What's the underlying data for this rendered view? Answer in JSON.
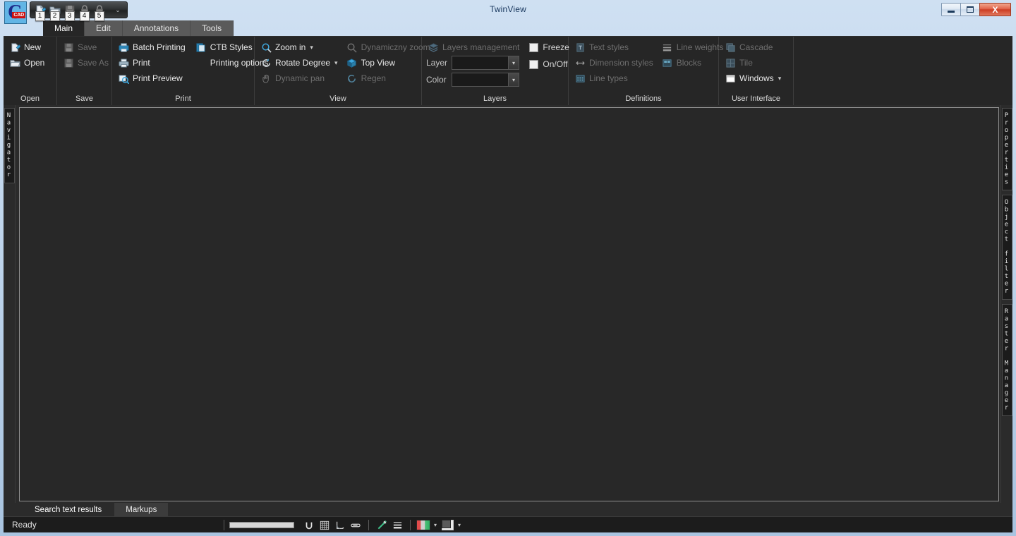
{
  "window": {
    "title": "TwinView",
    "minimize_label": "Minimize",
    "maximize_label": "Maximize",
    "close_label": "X"
  },
  "logo": {
    "letter": "C",
    "badge": "CAD"
  },
  "quick_access": {
    "items": [
      {
        "name": "new-document",
        "keytip": "1"
      },
      {
        "name": "open-document",
        "keytip": "2"
      },
      {
        "name": "save-document",
        "keytip": "3"
      },
      {
        "name": "lock-a",
        "keytip": "4"
      },
      {
        "name": "lock-b",
        "keytip": "5"
      }
    ],
    "customize_caret": "⌄"
  },
  "ribbon_tabs": [
    {
      "label": "Main",
      "active": true
    },
    {
      "label": "Edit",
      "active": false
    },
    {
      "label": "Annotations",
      "active": false
    },
    {
      "label": "Tools",
      "active": false
    }
  ],
  "ribbon": {
    "groups": [
      {
        "title": "Open",
        "items": [
          {
            "label": "New",
            "icon": "new-file-icon",
            "disabled": false
          },
          {
            "label": "Open",
            "icon": "open-folder-icon",
            "disabled": false
          }
        ]
      },
      {
        "title": "Save",
        "items": [
          {
            "label": "Save",
            "icon": "save-disk-icon",
            "disabled": true
          },
          {
            "label": "Save As",
            "icon": "save-as-disk-icon",
            "disabled": true
          }
        ]
      },
      {
        "title": "Print",
        "col1": [
          {
            "label": "Batch Printing",
            "icon": "batch-printing-icon",
            "disabled": false
          },
          {
            "label": "Print",
            "icon": "printer-icon",
            "disabled": false
          },
          {
            "label": "Print Preview",
            "icon": "print-preview-icon",
            "disabled": false
          }
        ],
        "col2": [
          {
            "label": "CTB Styles",
            "icon": "ctb-styles-icon",
            "disabled": false
          },
          {
            "label": "Printing options",
            "icon": "none",
            "disabled": false
          }
        ]
      },
      {
        "title": "View",
        "col1": [
          {
            "label": "Zoom in",
            "icon": "zoom-in-icon",
            "disabled": false,
            "caret": true
          },
          {
            "label": "Rotate Degree",
            "icon": "rotate-icon",
            "disabled": false,
            "caret": true
          },
          {
            "label": "Dynamic pan",
            "icon": "hand-pan-icon",
            "disabled": true
          }
        ],
        "col2": [
          {
            "label": "Dynamiczny zoom",
            "icon": "dynamic-zoom-icon",
            "disabled": true
          },
          {
            "label": "Top View",
            "icon": "top-view-icon",
            "disabled": false,
            "caret": true
          },
          {
            "label": "Regen",
            "icon": "regen-icon",
            "disabled": true
          }
        ]
      },
      {
        "title": "Layers",
        "management_label": "Layers management",
        "layer_label": "Layer",
        "color_label": "Color",
        "layer_value": "",
        "color_value": "",
        "checkboxes": [
          {
            "label": "Freeze",
            "checked": false
          },
          {
            "label": "On/Off",
            "checked": false
          }
        ]
      },
      {
        "title": "Definitions",
        "col1": [
          {
            "label": "Text styles",
            "icon": "text-styles-icon",
            "disabled": true
          },
          {
            "label": "Dimension styles",
            "icon": "dimension-styles-icon",
            "disabled": true
          },
          {
            "label": "Line types",
            "icon": "line-types-icon",
            "disabled": true
          }
        ],
        "col2": [
          {
            "label": "Line weights",
            "icon": "line-weights-icon",
            "disabled": true
          },
          {
            "label": "Blocks",
            "icon": "blocks-icon",
            "disabled": true
          }
        ]
      },
      {
        "title": "User Interface",
        "items": [
          {
            "label": "Cascade",
            "icon": "cascade-icon",
            "disabled": true
          },
          {
            "label": "Tile",
            "icon": "tile-icon",
            "disabled": true
          },
          {
            "label": "Windows",
            "icon": "windows-icon",
            "disabled": false,
            "caret": true
          }
        ]
      }
    ]
  },
  "left_panel": {
    "tabs": [
      {
        "label": "Navigator"
      }
    ]
  },
  "right_panel": {
    "tabs": [
      {
        "label": "Properties"
      },
      {
        "label": "Object filter"
      },
      {
        "label": "Raster Manager"
      }
    ]
  },
  "bottom_tabs": [
    {
      "label": "Search text results",
      "active": true
    },
    {
      "label": "Markups",
      "active": false
    }
  ],
  "statusbar": {
    "text": "Ready",
    "tools": [
      {
        "name": "zoom-slider",
        "type": "slider"
      },
      {
        "name": "snap-magnet-icon",
        "type": "icon",
        "glyph": "U"
      },
      {
        "name": "grid-icon",
        "type": "icon"
      },
      {
        "name": "ortho-icon",
        "type": "icon"
      },
      {
        "name": "measure-icon",
        "type": "icon"
      },
      {
        "name": "pointer-tool-icon",
        "type": "icon"
      },
      {
        "name": "lineweight-icon",
        "type": "icon"
      },
      {
        "name": "color-swatch",
        "type": "swatch"
      },
      {
        "name": "layer-swatch",
        "type": "swatch"
      }
    ],
    "caret": "⌄"
  },
  "colors": {
    "ribbon_bg": "#262626",
    "canvas_bg": "#282828",
    "accent_blue": "#3fa9e0",
    "frame_blue": "#bdd3ea",
    "disabled_text": "#6e6e6e"
  }
}
